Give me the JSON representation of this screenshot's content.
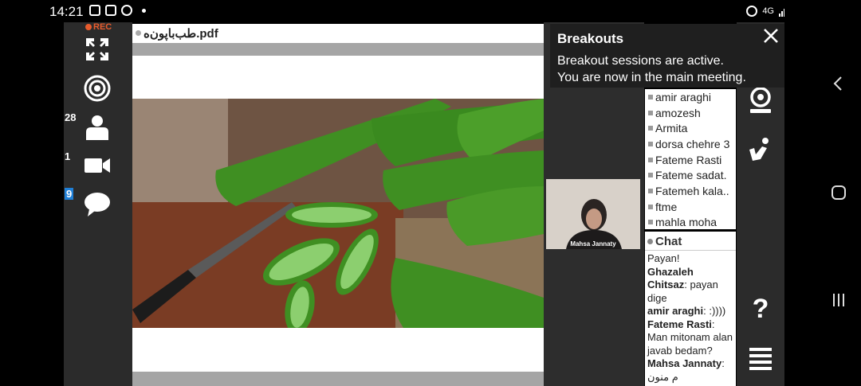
{
  "status": {
    "time": "14:21",
    "network": "4G"
  },
  "toolbar": {
    "rec_label": "REC",
    "participants_count": "28",
    "video_count": "1",
    "chat_count": "9"
  },
  "document": {
    "title": "طب‌باپون‌ه.pdf"
  },
  "breakouts": {
    "title": "Breakouts",
    "line1": "Breakout sessions are active.",
    "line2": "You are now in the main meeting."
  },
  "video": {
    "name": "Mahsa Jannaty"
  },
  "users": [
    "amir araghi",
    "amozesh",
    "Armita",
    "dorsa chehre 3",
    "Fateme Rasti",
    "Fateme sadat.",
    "Fatemeh kala..",
    "ftme",
    "mahla moha"
  ],
  "chat": {
    "title": "Chat",
    "messages": [
      {
        "author": "",
        "text": "Payan!"
      },
      {
        "author": "Ghazaleh Chitsaz",
        "text": "payan dige"
      },
      {
        "author": "amir araghi",
        "text": ":))))"
      },
      {
        "author": "Fateme Rasti",
        "text": "Man mitonam alan javab bedam?"
      },
      {
        "author": "Mahsa Jannaty",
        "text": "م منون"
      }
    ]
  },
  "colors": {
    "accent": "#e85b2c",
    "badge": "#1f7fd6",
    "panel": "#2b2b2b"
  }
}
